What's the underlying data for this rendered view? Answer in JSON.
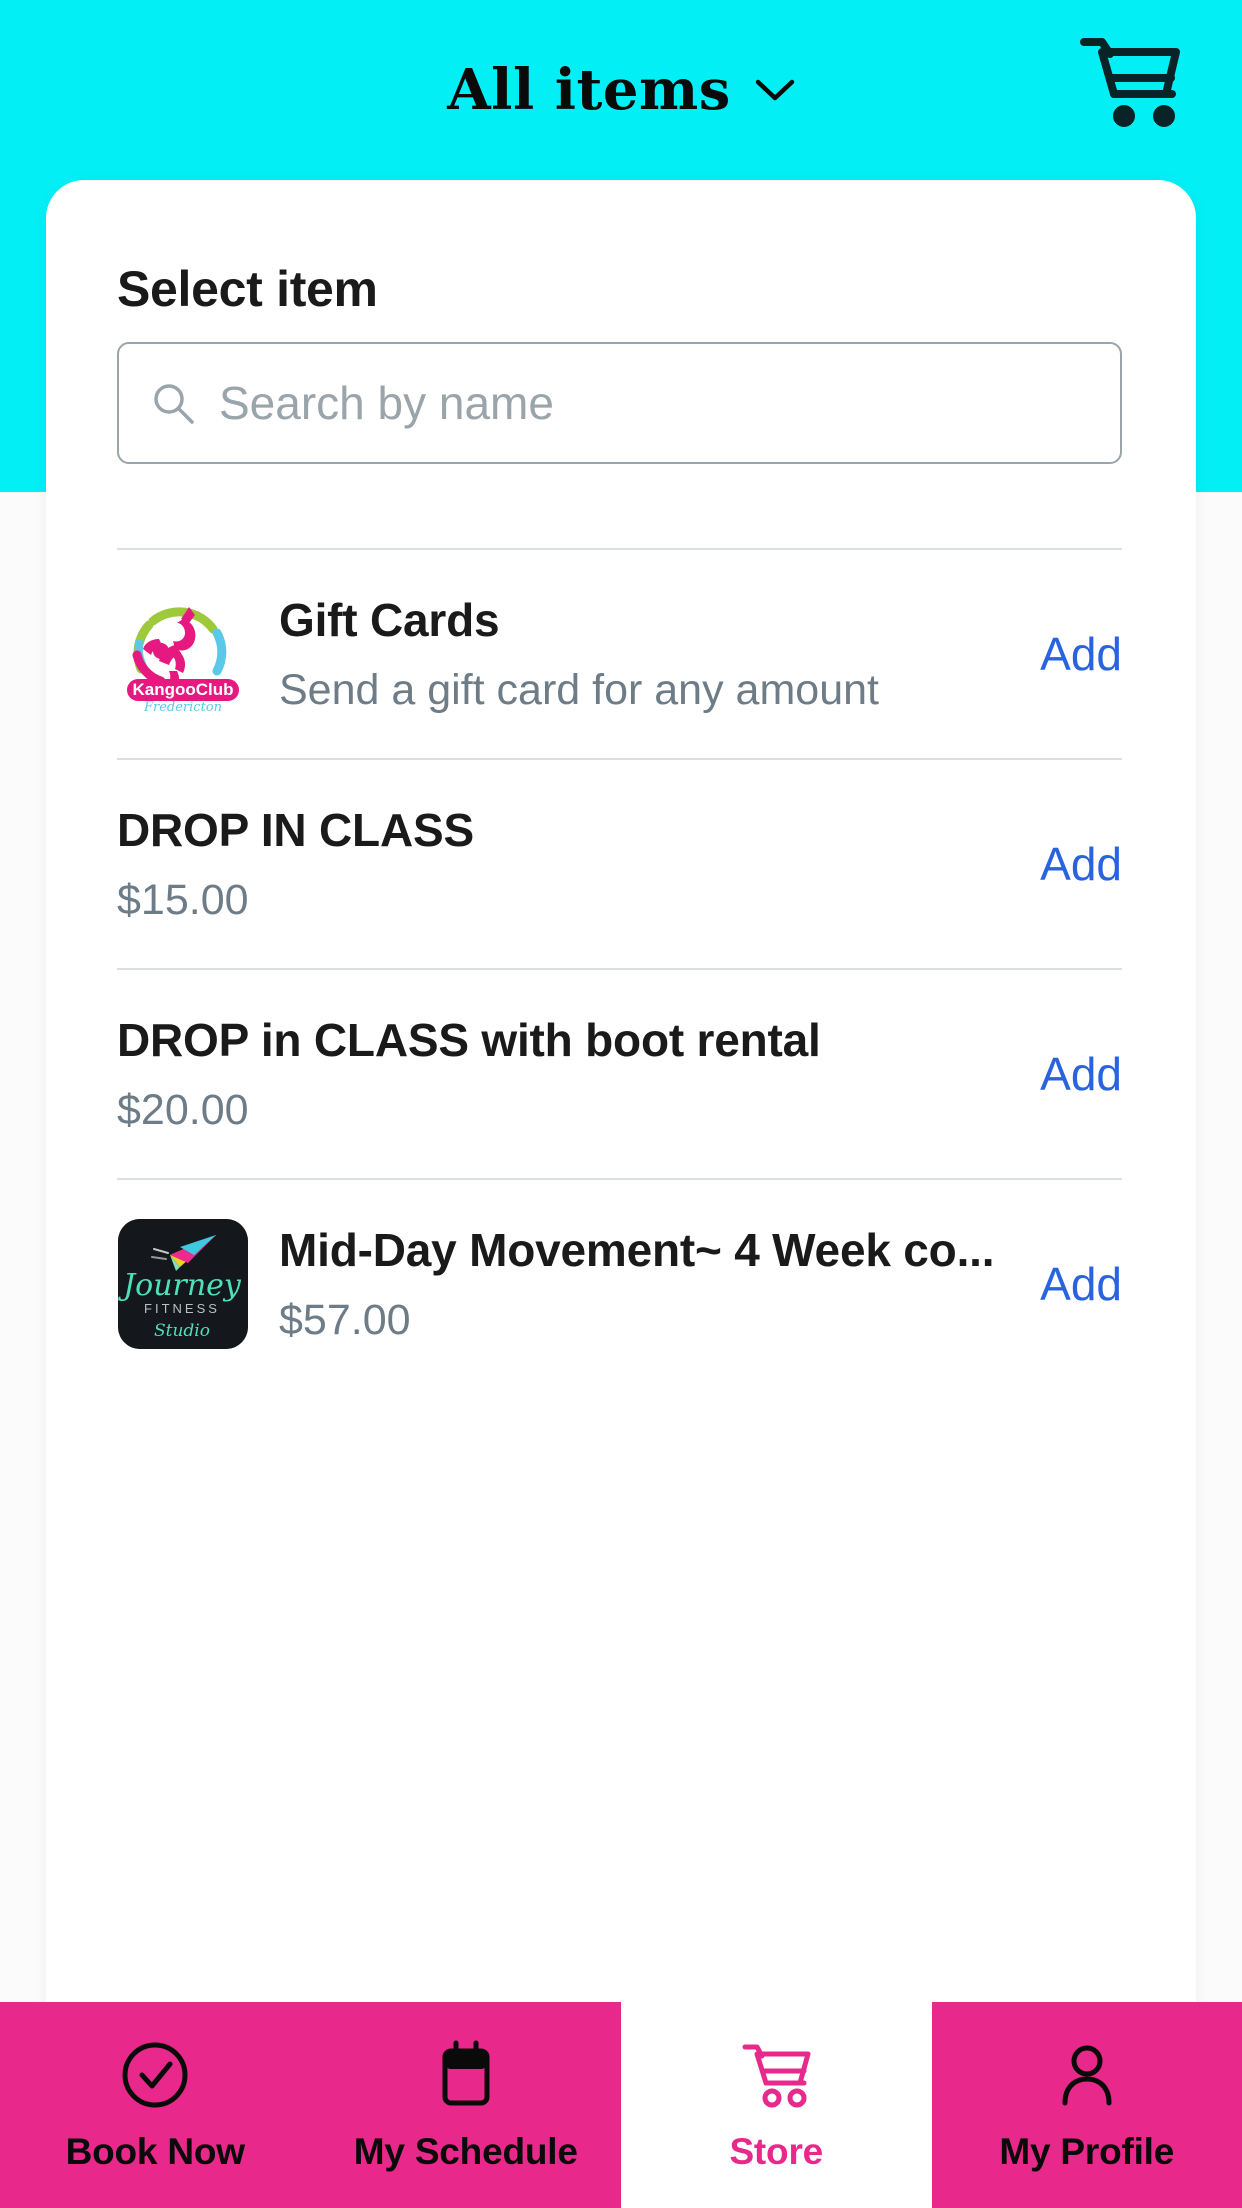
{
  "header": {
    "title": "All items",
    "dropdown_icon": "chevron-down-icon",
    "cart_icon": "shopping-cart-icon",
    "background_color": "#03EFF6"
  },
  "sheet": {
    "title": "Select item"
  },
  "search": {
    "placeholder": "Search by name",
    "value": "",
    "icon": "search-icon"
  },
  "items": [
    {
      "title": "Gift Cards",
      "subtitle": "Send a gift card for any amount",
      "action_label": "Add",
      "thumbnail": "kangooclub-fredericton-logo",
      "has_thumbnail": true
    },
    {
      "title": "DROP IN CLASS",
      "subtitle": "$15.00",
      "action_label": "Add",
      "thumbnail": "",
      "has_thumbnail": false
    },
    {
      "title": "DROP in CLASS with boot rental",
      "subtitle": "$20.00",
      "action_label": "Add",
      "thumbnail": "",
      "has_thumbnail": false
    },
    {
      "title": "Mid-Day Movement~ 4 Week co...",
      "subtitle": "$57.00",
      "action_label": "Add",
      "thumbnail": "journey-fitness-studio-logo",
      "has_thumbnail": true
    }
  ],
  "bottom_nav": {
    "active_color": "#E8288A",
    "items": [
      {
        "label": "Book Now",
        "icon": "check-circle-icon",
        "active": false
      },
      {
        "label": "My Schedule",
        "icon": "calendar-icon",
        "active": false
      },
      {
        "label": "Store",
        "icon": "shopping-cart-icon",
        "active": true
      },
      {
        "label": "My Profile",
        "icon": "person-icon",
        "active": false
      }
    ]
  },
  "colors": {
    "header_cyan": "#03EFF6",
    "brand_pink": "#E8288A",
    "add_link_blue": "#2A63E0",
    "subtitle_gray": "#6D7C86"
  }
}
